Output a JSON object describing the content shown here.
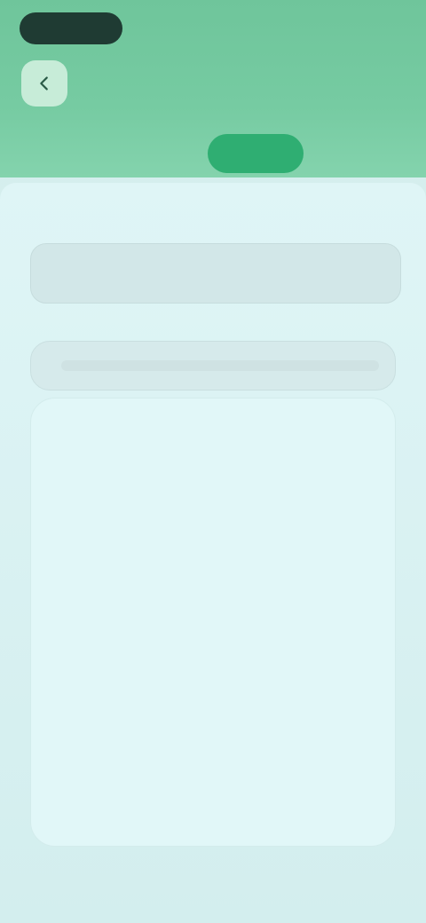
{
  "status": {
    "time": ""
  },
  "header": {
    "title": "",
    "back_icon": "back-arrow-icon"
  },
  "tabs": [
    {
      "label": ""
    },
    {
      "label": ""
    },
    {
      "label": ""
    },
    {
      "label": ""
    }
  ],
  "main": {
    "section_label": "",
    "search": {
      "placeholder": "",
      "value": ""
    },
    "hint_left": "",
    "hint_right": "",
    "bar_label": "",
    "items": [
      {
        "title": "",
        "desc": ""
      },
      {
        "title": "",
        "desc": ""
      },
      {
        "title": "",
        "desc": ""
      },
      {
        "title": "",
        "desc": ""
      }
    ]
  },
  "colors": {
    "header_green": "#76cba2",
    "active_tab": "#2fae72",
    "panel_bg": "#e1f7f8",
    "page_bg": "#d8f0ef"
  }
}
